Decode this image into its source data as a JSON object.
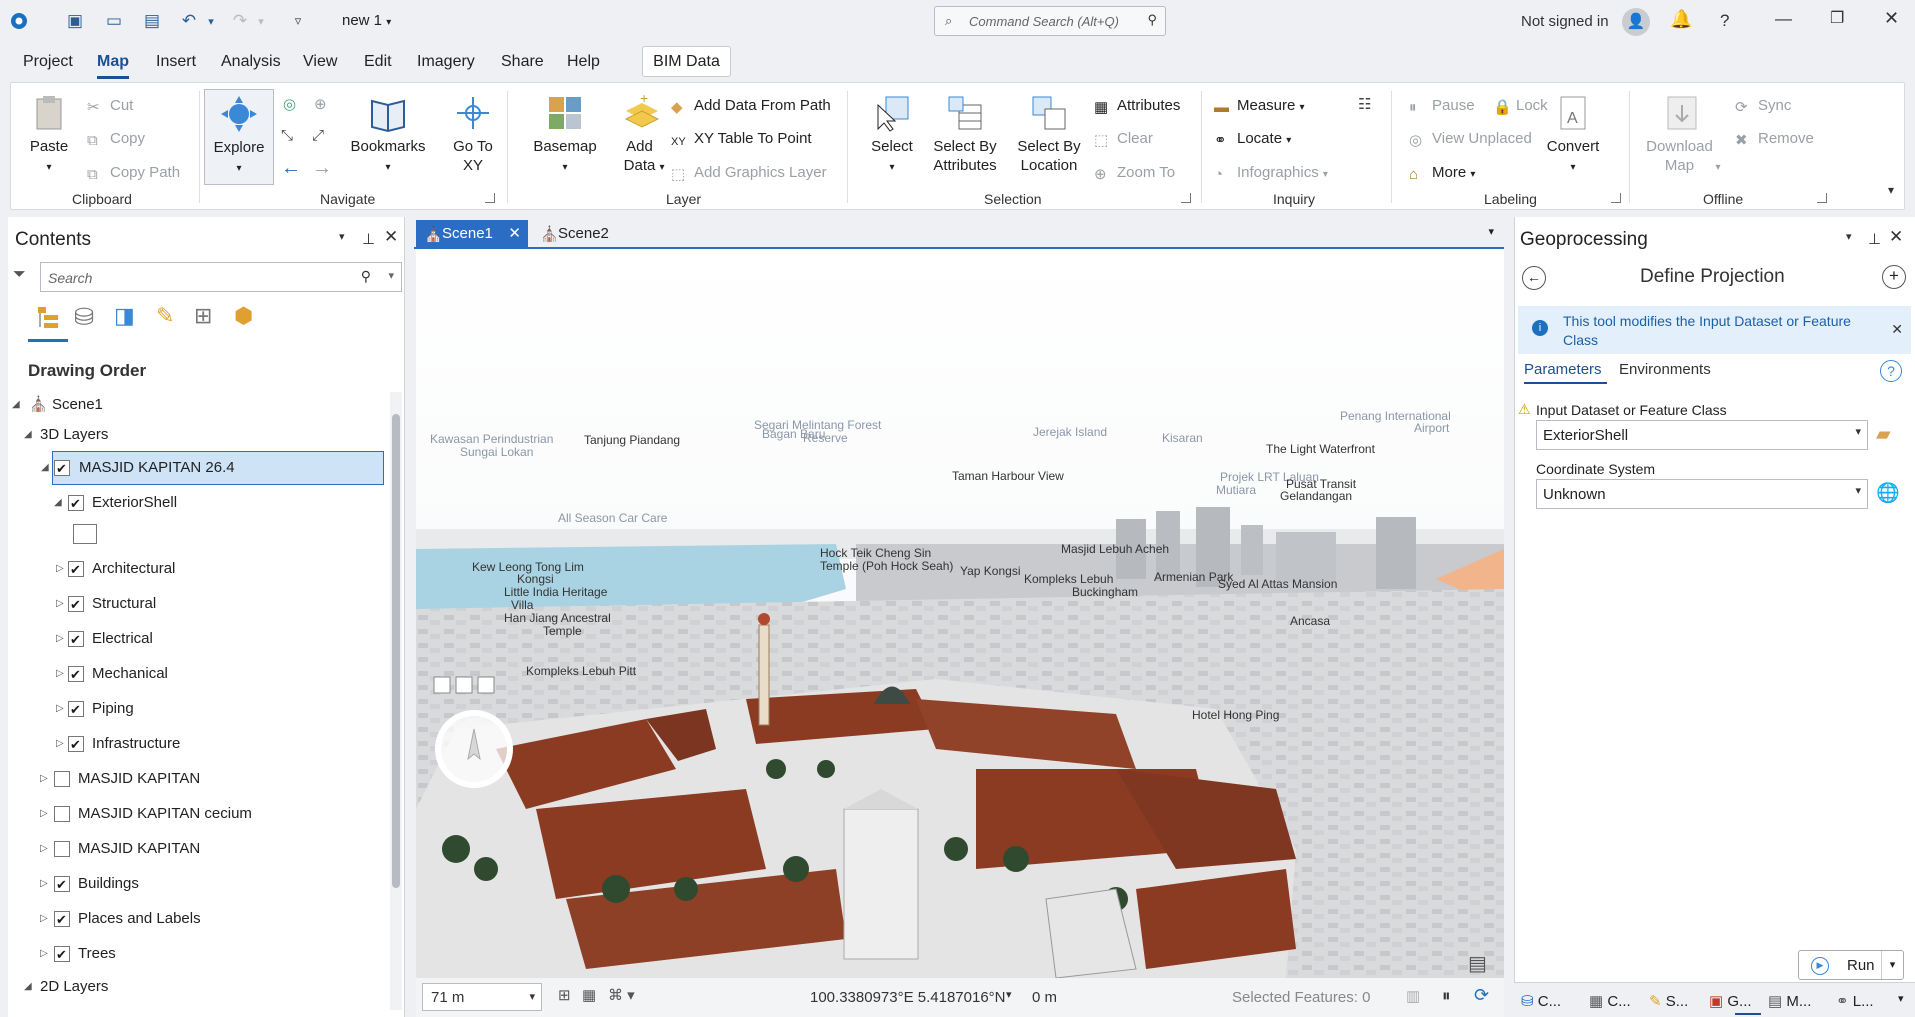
{
  "titlebar": {
    "doc_name": "new 1",
    "command_search_placeholder": "Command Search (Alt+Q)",
    "signin": "Not signed in"
  },
  "menu": {
    "items": [
      "Project",
      "Map",
      "Insert",
      "Analysis",
      "View",
      "Edit",
      "Imagery",
      "Share",
      "Help"
    ],
    "active": "Map",
    "context_tab": "BIM Data"
  },
  "ribbon": {
    "clipboard": {
      "label": "Clipboard",
      "paste": "Paste",
      "cut": "Cut",
      "copy": "Copy",
      "copy_path": "Copy Path"
    },
    "navigate": {
      "label": "Navigate",
      "explore": "Explore",
      "bookmarks": "Bookmarks",
      "goto_xy": "Go To XY"
    },
    "layer": {
      "label": "Layer",
      "basemap": "Basemap",
      "add_data": "Add Data",
      "add_data_from_path": "Add Data From Path",
      "xy_table": "XY Table To Point",
      "add_graphics": "Add Graphics Layer"
    },
    "selection": {
      "label": "Selection",
      "select": "Select",
      "select_by_attributes": "Select By Attributes",
      "select_by_location": "Select By Location",
      "attributes": "Attributes",
      "clear": "Clear",
      "zoom_to": "Zoom To"
    },
    "inquiry": {
      "label": "Inquiry",
      "measure": "Measure",
      "locate": "Locate",
      "infographics": "Infographics"
    },
    "labeling": {
      "label": "Labeling",
      "pause": "Pause",
      "lock": "Lock",
      "view_unplaced": "View Unplaced",
      "more": "More",
      "convert": "Convert"
    },
    "offline": {
      "label": "Offline",
      "download_map": "Download Map",
      "sync": "Sync",
      "remove": "Remove"
    }
  },
  "contents": {
    "title": "Contents",
    "search_placeholder": "Search",
    "section": "Drawing Order",
    "scene": "Scene1",
    "group_3d": "3D Layers",
    "selected_layer": "MASJID KAPITAN 26.4",
    "exterior": "ExteriorShell",
    "sublayers": [
      {
        "label": "Architectural",
        "checked": true
      },
      {
        "label": "Structural",
        "checked": true
      },
      {
        "label": "Electrical",
        "checked": true
      },
      {
        "label": "Mechanical",
        "checked": true
      },
      {
        "label": "Piping",
        "checked": true
      },
      {
        "label": "Infrastructure",
        "checked": true
      }
    ],
    "layers": [
      {
        "label": "MASJID KAPITAN",
        "checked": false
      },
      {
        "label": "MASJID KAPITAN cecium",
        "checked": false
      },
      {
        "label": "MASJID KAPITAN",
        "checked": false
      },
      {
        "label": "Buildings",
        "checked": true
      },
      {
        "label": "Places and Labels",
        "checked": true
      },
      {
        "label": "Trees",
        "checked": true
      }
    ],
    "group_2d": "2D Layers"
  },
  "map": {
    "tabs": [
      "Scene1",
      "Scene2"
    ],
    "labels": [
      "Kawasan Perindustrian",
      "Tanjung Piandang",
      "Sungai Lokan",
      "Segari Melintang Forest",
      "Bagan Baru",
      "Reserve",
      "Jerejak Island",
      "Kisaran",
      "Penang International",
      "Airport",
      "The Light Waterfront",
      "Taman Harbour View",
      "Projek LRT Laluan",
      "Mutiara",
      "Pusat Transit",
      "Gelandangan",
      "All Season Car Care",
      "Hock Teik Cheng Sin",
      "Temple (Poh Hock Seah)",
      "Masjid Lebuh Acheh",
      "Kew Leong Tong Lim",
      "Kongsi",
      "Little India Heritage",
      "Villa",
      "Han Jiang Ancestral",
      "Temple",
      "Yap Kongsi",
      "Kompleks Lebuh",
      "Buckingham",
      "Armenian Park",
      "Syed Al Attas Mansion",
      "Kompleks Lebuh Pitt",
      "Hotel Hong Ping",
      "Ancasa"
    ],
    "scale": "71 m",
    "coordinates": "100.3380973°E 5.4187016°N",
    "elevation": "0 m",
    "selected_features": "Selected Features: 0"
  },
  "geoprocessing": {
    "title": "Geoprocessing",
    "tool": "Define Projection",
    "info": "This tool modifies the Input Dataset or Feature Class",
    "tabs": [
      "Parameters",
      "Environments"
    ],
    "input_label": "Input Dataset or Feature Class",
    "input_value": "ExteriorShell",
    "cs_label": "Coordinate System",
    "cs_value": "Unknown",
    "run": "Run"
  },
  "bottom_tabs": [
    "C...",
    "C...",
    "S...",
    "G...",
    "M...",
    "L..."
  ],
  "colors": {
    "accent": "#1d4f91",
    "selection": "#cfe3f7",
    "water": "#a9d3e2",
    "roof": "#8a3b22"
  }
}
